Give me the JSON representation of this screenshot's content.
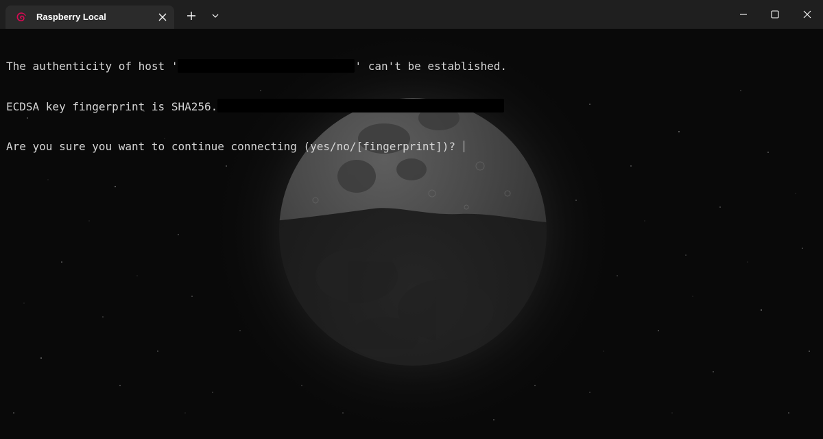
{
  "window": {
    "tab_title": "Raspberry Local",
    "tab_icon": "debian-swirl-icon",
    "accent_color": "#d70a53",
    "controls": [
      "new-tab-plus-icon",
      "chevron-down-icon",
      "minimize-icon",
      "maximize-icon",
      "close-icon"
    ]
  },
  "terminal": {
    "line1_prefix": "The authenticity of host '",
    "line1_suffix": "' can't be established.",
    "line2_prefix": "ECDSA key fingerprint is SHA256.",
    "line3_prompt": "Are you sure you want to continue connecting (yes/no/[fingerprint])? ",
    "background": "moon-starfield"
  }
}
